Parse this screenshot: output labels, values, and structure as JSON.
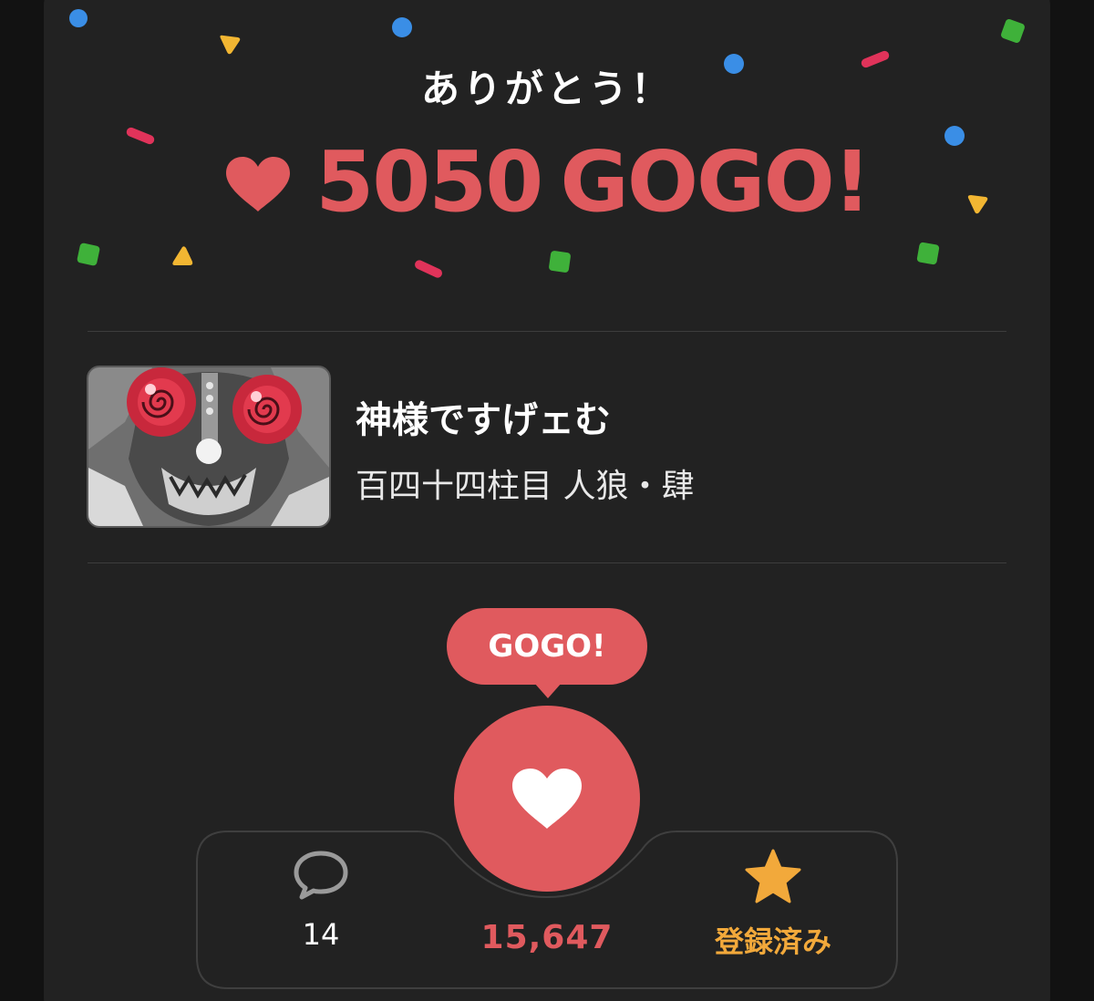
{
  "colors": {
    "accent": "#e05a5e",
    "star": "#f2a93b",
    "card_bg": "#222222",
    "confetti_blue": "#3a8ee6",
    "confetti_yellow": "#f2b632",
    "confetti_green": "#3fb13a",
    "confetti_pink": "#e0335a"
  },
  "header": {
    "thanks": "ありがとう！",
    "heart_icon": "heart-icon",
    "amount": "5050",
    "gogo": "GOGO!"
  },
  "work": {
    "title": "神様ですげェむ",
    "episode": "百四十四柱目 人狼・肆",
    "thumbnail_icon": "manga-thumbnail"
  },
  "gogo_button": {
    "bubble": "GOGO!",
    "icon": "heart-icon",
    "count": "15,647"
  },
  "actions": {
    "comment": {
      "icon": "speech-bubble-icon",
      "count": "14"
    },
    "register": {
      "icon": "star-icon",
      "label": "登録済み"
    }
  }
}
